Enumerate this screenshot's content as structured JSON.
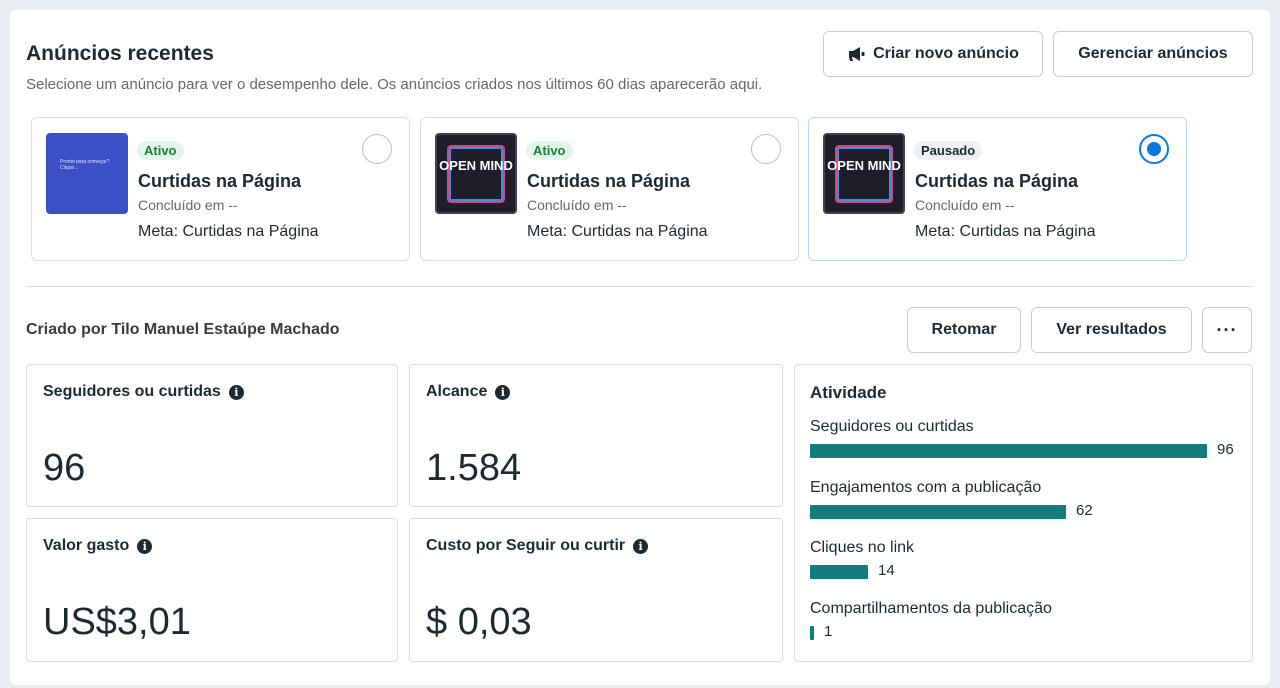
{
  "header": {
    "title": "Anúncios recentes",
    "subtitle": "Selecione um anúncio para ver o desempenho dele. Os anúncios criados nos últimos 60 dias aparecerão aqui.",
    "create_label": "Criar novo anúncio",
    "create_icon": "megaphone-icon",
    "manage_label": "Gerenciar anúncios"
  },
  "ads": [
    {
      "status": "Ativo",
      "title": "Curtidas na Página",
      "concluded": "Concluído em --",
      "goal": "Meta: Curtidas na Página",
      "selected": false,
      "thumb_text": "Pronto para começar? Clique..."
    },
    {
      "status": "Ativo",
      "title": "Curtidas na Página",
      "concluded": "Concluído em --",
      "goal": "Meta: Curtidas na Página",
      "selected": false,
      "thumb_text": "OPEN MIND"
    },
    {
      "status": "Pausado",
      "title": "Curtidas na Página",
      "concluded": "Concluído em --",
      "goal": "Meta: Curtidas na Página",
      "selected": true,
      "thumb_text": "OPEN MIND"
    }
  ],
  "detail": {
    "creator": "Criado por Tilo Manuel Estaúpe Machado",
    "resume_label": "Retomar",
    "results_label": "Ver resultados",
    "more_label": "···"
  },
  "metrics": {
    "followers": {
      "label": "Seguidores ou curtidas",
      "value": "96"
    },
    "reach": {
      "label": "Alcance",
      "value": "1.584"
    },
    "spent": {
      "label": "Valor gasto",
      "value": "US$3,01"
    },
    "cost": {
      "label": "Custo por Seguir ou curtir",
      "value": "$ 0,03"
    }
  },
  "activity": {
    "title": "Atividade",
    "bar_color": "#137c7c",
    "max": 96,
    "rows": [
      {
        "label": "Seguidores ou curtidas",
        "value": 96
      },
      {
        "label": "Engajamentos com a publicação",
        "value": 62
      },
      {
        "label": "Cliques no link",
        "value": 14
      },
      {
        "label": "Compartilhamentos da publicação",
        "value": 1
      }
    ]
  }
}
